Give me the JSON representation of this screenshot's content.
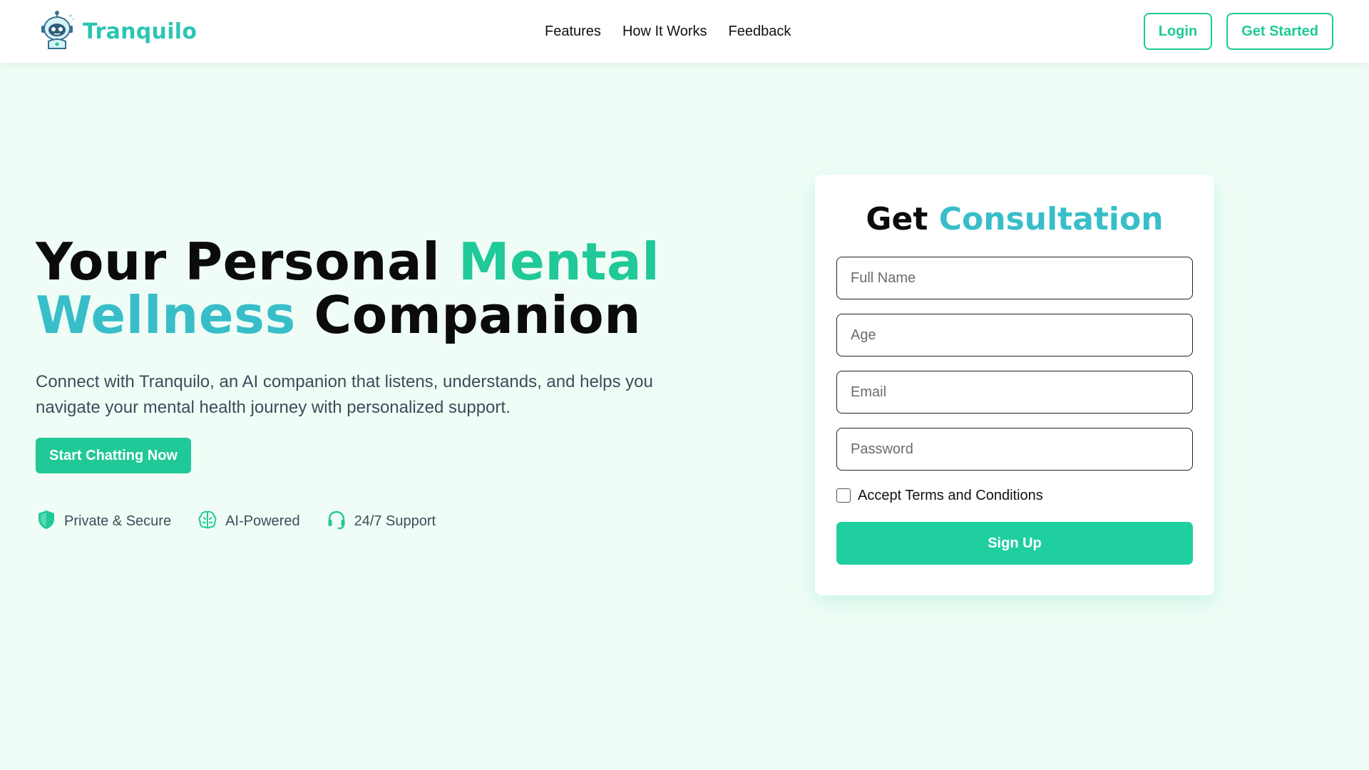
{
  "header": {
    "brand_name": "Tranquilo",
    "brand_icon": "robot-mascot-icon",
    "nav_links": [
      "Features",
      "How It Works",
      "Feedback"
    ],
    "login_label": "Login",
    "get_started_label": "Get Started"
  },
  "hero": {
    "title_part1": "Your Personal ",
    "title_highlight1": "Mental",
    "title_highlight2": "Wellness",
    "title_part2": " Companion",
    "description": "Connect with Tranquilo, an AI companion that listens, understands, and helps you navigate your mental health journey with personalized support.",
    "cta_label": "Start Chatting Now",
    "features": [
      {
        "label": "Private & Secure",
        "icon": "shield-icon"
      },
      {
        "label": "AI-Powered",
        "icon": "brain-icon"
      },
      {
        "label": "24/7 Support",
        "icon": "headset-icon"
      }
    ]
  },
  "form": {
    "title_plain": "Get ",
    "title_accent": "Consultation",
    "full_name_placeholder": "Full Name",
    "age_placeholder": "Age",
    "email_placeholder": "Email",
    "password_placeholder": "Password",
    "terms_label": "Accept Terms and Conditions",
    "terms_checked": false,
    "submit_label": "Sign Up"
  },
  "colors": {
    "accent_green": "#20c997",
    "accent_teal": "#38bec9",
    "page_background": "#f0fdf6"
  }
}
